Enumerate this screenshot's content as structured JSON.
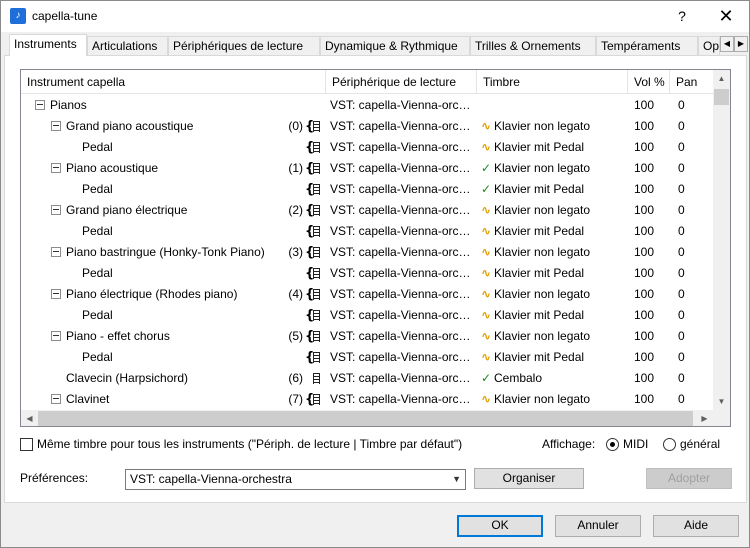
{
  "window": {
    "title": "capella-tune",
    "app_icon_glyph": "♪",
    "help": "?",
    "close": "✕"
  },
  "tabs": [
    {
      "label": "Instruments",
      "active": true
    },
    {
      "label": "Articulations"
    },
    {
      "label": "Périphériques de lecture"
    },
    {
      "label": "Dynamique & Rythmique"
    },
    {
      "label": "Trilles & Ornements"
    },
    {
      "label": "Tempéraments"
    },
    {
      "label": "Op"
    }
  ],
  "table": {
    "columns": [
      "Instrument capella",
      "Périphérique de lecture",
      "Timbre",
      "Vol %",
      "Pan"
    ],
    "rows": [
      {
        "level": 0,
        "expand": true,
        "name": "Pianos",
        "idx": "",
        "brace": "",
        "device": "VST: capella-Vienna-orchestra",
        "mark": "",
        "timbre": "",
        "vol": "100",
        "pan": "0"
      },
      {
        "level": 1,
        "expand": true,
        "name": "Grand piano acoustique",
        "idx": "(0)",
        "brace": "{",
        "device": "VST: capella-Vienna-orchestra",
        "mark": "tilde",
        "timbre": "Klavier non legato",
        "vol": "100",
        "pan": "0"
      },
      {
        "level": 2,
        "expand": false,
        "name": "Pedal",
        "idx": "",
        "brace": "{",
        "device": "VST: capella-Vienna-orchestra",
        "mark": "tilde",
        "timbre": "Klavier mit Pedal",
        "vol": "100",
        "pan": "0"
      },
      {
        "level": 1,
        "expand": true,
        "name": "Piano acoustique",
        "idx": "(1)",
        "brace": "{",
        "device": "VST: capella-Vienna-orchestra",
        "mark": "check",
        "timbre": "Klavier non legato",
        "vol": "100",
        "pan": "0"
      },
      {
        "level": 2,
        "expand": false,
        "name": "Pedal",
        "idx": "",
        "brace": "{",
        "device": "VST: capella-Vienna-orchestra",
        "mark": "check",
        "timbre": "Klavier mit Pedal",
        "vol": "100",
        "pan": "0"
      },
      {
        "level": 1,
        "expand": true,
        "name": "Grand piano électrique",
        "idx": "(2)",
        "brace": "{",
        "device": "VST: capella-Vienna-orchestra",
        "mark": "tilde",
        "timbre": "Klavier non legato",
        "vol": "100",
        "pan": "0"
      },
      {
        "level": 2,
        "expand": false,
        "name": "Pedal",
        "idx": "",
        "brace": "{",
        "device": "VST: capella-Vienna-orchestra",
        "mark": "tilde",
        "timbre": "Klavier mit Pedal",
        "vol": "100",
        "pan": "0"
      },
      {
        "level": 1,
        "expand": true,
        "name": "Piano bastringue (Honky-Tonk Piano)",
        "idx": "(3)",
        "brace": "{",
        "device": "VST: capella-Vienna-orchestra",
        "mark": "tilde",
        "timbre": "Klavier non legato",
        "vol": "100",
        "pan": "0"
      },
      {
        "level": 2,
        "expand": false,
        "name": "Pedal",
        "idx": "",
        "brace": "{",
        "device": "VST: capella-Vienna-orchestra",
        "mark": "tilde",
        "timbre": "Klavier mit Pedal",
        "vol": "100",
        "pan": "0"
      },
      {
        "level": 1,
        "expand": true,
        "name": "Piano électrique (Rhodes piano)",
        "idx": "(4)",
        "brace": "{",
        "device": "VST: capella-Vienna-orchestra",
        "mark": "tilde",
        "timbre": "Klavier non legato",
        "vol": "100",
        "pan": "0"
      },
      {
        "level": 2,
        "expand": false,
        "name": "Pedal",
        "idx": "",
        "brace": "{",
        "device": "VST: capella-Vienna-orchestra",
        "mark": "tilde",
        "timbre": "Klavier mit Pedal",
        "vol": "100",
        "pan": "0"
      },
      {
        "level": 1,
        "expand": true,
        "name": "Piano - effet chorus",
        "idx": "(5)",
        "brace": "{",
        "device": "VST: capella-Vienna-orchestra",
        "mark": "tilde",
        "timbre": "Klavier non legato",
        "vol": "100",
        "pan": "0"
      },
      {
        "level": 2,
        "expand": false,
        "name": "Pedal",
        "idx": "",
        "brace": "{",
        "device": "VST: capella-Vienna-orchestra",
        "mark": "tilde",
        "timbre": "Klavier mit Pedal",
        "vol": "100",
        "pan": "0"
      },
      {
        "level": 1,
        "expand": false,
        "name": "Clavecin (Harpsichord)",
        "idx": "(6)",
        "brace": "",
        "device": "VST: capella-Vienna-orchestra",
        "mark": "check",
        "timbre": "Cembalo",
        "vol": "100",
        "pan": "0"
      },
      {
        "level": 1,
        "expand": true,
        "name": "Clavinet",
        "idx": "(7)",
        "brace": "{",
        "device": "VST: capella-Vienna-orchestra",
        "mark": "tilde",
        "timbre": "Klavier non legato",
        "vol": "100",
        "pan": "0"
      }
    ]
  },
  "options": {
    "same_timbre_label": "Même timbre pour tous les instruments (\"Périph. de lecture | Timbre par défaut\")",
    "same_timbre_checked": false,
    "display_label": "Affichage:",
    "midi_label": "MIDI",
    "general_label": "général",
    "selected_display": "MIDI"
  },
  "preferences": {
    "label": "Préférences:",
    "value": "VST: capella-Vienna-orchestra",
    "organize": "Organiser",
    "adopt": "Adopter"
  },
  "footer": {
    "ok": "OK",
    "cancel": "Annuler",
    "help": "Aide"
  },
  "colors": {
    "accent": "#0078d7",
    "tilde": "#e0a000",
    "check": "#1a8a1a"
  }
}
